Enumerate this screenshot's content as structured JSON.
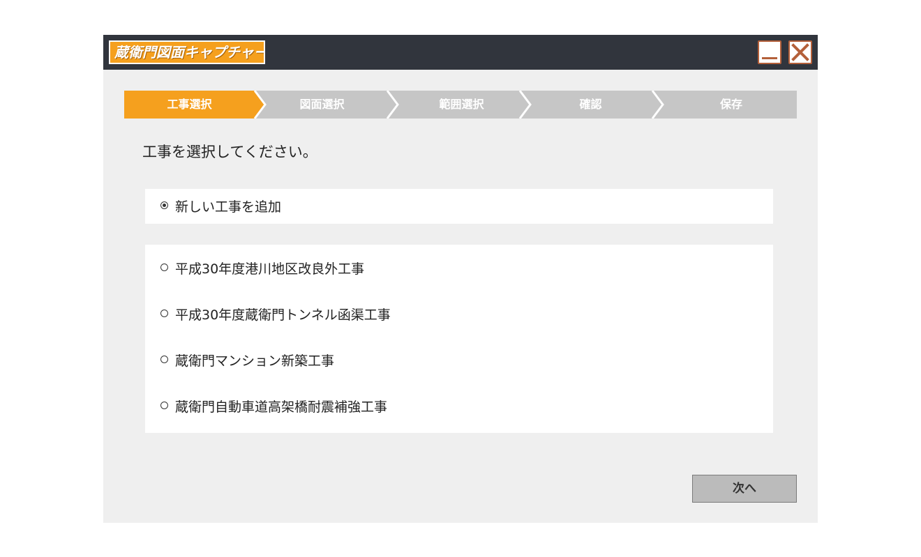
{
  "app": {
    "title": "蔵衛門図面キャプチャー"
  },
  "window_controls": {
    "minimize_icon": "minimize-icon",
    "close_icon": "close-icon"
  },
  "steps": [
    {
      "label": "工事選択",
      "active": true
    },
    {
      "label": "図面選択",
      "active": false
    },
    {
      "label": "範囲選択",
      "active": false
    },
    {
      "label": "確認",
      "active": false
    },
    {
      "label": "保存",
      "active": false
    }
  ],
  "prompt": "工事を選択してください。",
  "new_option": {
    "label": "新しい工事を追加",
    "selected": true
  },
  "projects": [
    {
      "label": "平成30年度港川地区改良外工事",
      "selected": false
    },
    {
      "label": "平成30年度蔵衛門トンネル函渠工事",
      "selected": false
    },
    {
      "label": "蔵衛門マンション新築工事",
      "selected": false
    },
    {
      "label": "蔵衛門自動車道高架橋耐震補強工事",
      "selected": false
    }
  ],
  "next_button": "次へ",
  "colors": {
    "titlebar": "#31353d",
    "accent": "#f5a01e",
    "step_inactive": "#c6c6c6",
    "window_bg": "#efefef",
    "button_bg": "#bbbbbb"
  }
}
